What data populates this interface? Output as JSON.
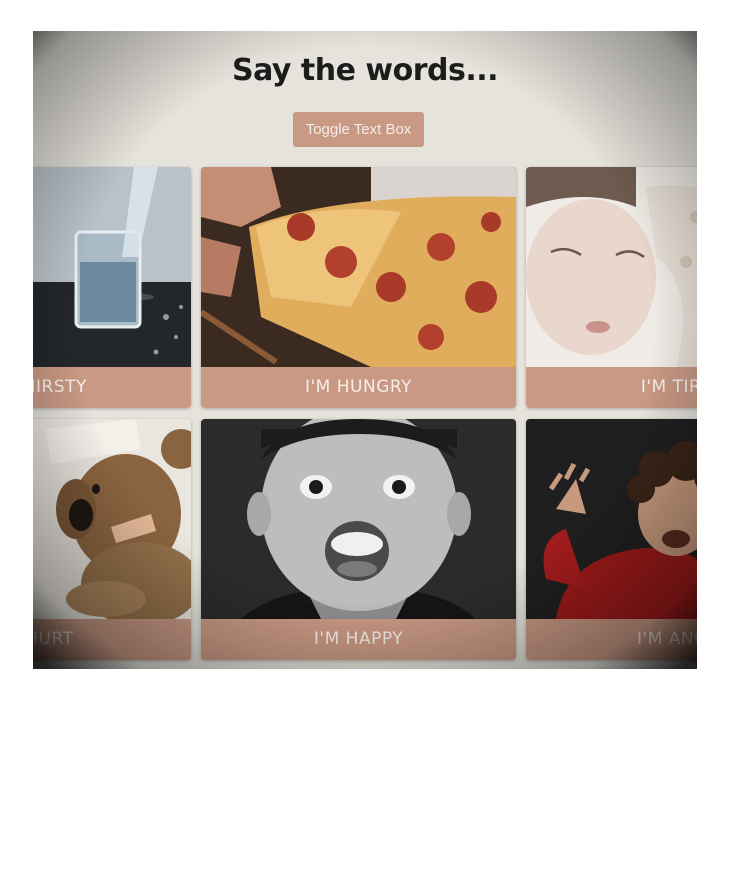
{
  "page": {
    "title": "Say the words..."
  },
  "toolbar": {
    "toggle_label": "Toggle Text Box"
  },
  "cards": [
    {
      "label": "I'M THIRSTY"
    },
    {
      "label": "I'M HUNGRY"
    },
    {
      "label": "I'M TIRED"
    },
    {
      "label": "I'M HURT"
    },
    {
      "label": "I'M HAPPY"
    },
    {
      "label": "I'M ANGRY"
    }
  ],
  "colors": {
    "accent": "#c99984",
    "background": "#e6e3dc",
    "title": "#1c1c1c"
  }
}
